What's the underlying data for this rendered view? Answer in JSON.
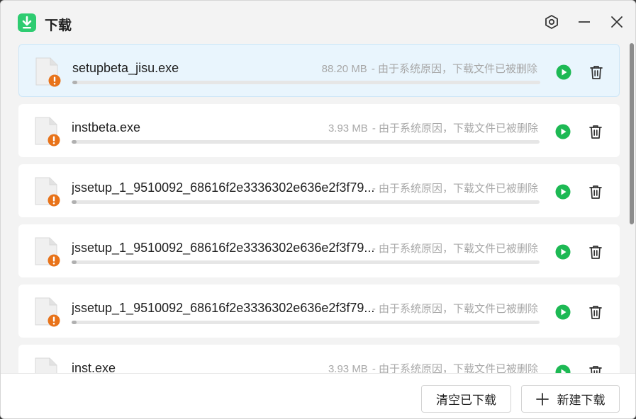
{
  "window": {
    "title": "下载",
    "app_icon": "download-arrow-icon",
    "controls": [
      "settings-icon",
      "minimize-icon",
      "close-icon"
    ]
  },
  "downloads": [
    {
      "name": "setupbeta_jisu.exe",
      "size": "88.20 MB",
      "status": "- 由于系统原因，下载文件已被删除",
      "progress": 0.01,
      "selected": true
    },
    {
      "name": "instbeta.exe",
      "size": "3.93 MB",
      "status": "- 由于系统原因，下载文件已被删除",
      "progress": 0.01,
      "selected": false
    },
    {
      "name": "jssetup_1_9510092_68616f2e3336302e636e2f3f79...",
      "size": "",
      "status": "- 由于系统原因，下载文件已被删除",
      "progress": 0.01,
      "selected": false
    },
    {
      "name": "jssetup_1_9510092_68616f2e3336302e636e2f3f79...",
      "size": "",
      "status": "- 由于系统原因，下载文件已被删除",
      "progress": 0.01,
      "selected": false
    },
    {
      "name": "jssetup_1_9510092_68616f2e3336302e636e2f3f79...",
      "size": "",
      "status": "- 由于系统原因，下载文件已被删除",
      "progress": 0.01,
      "selected": false
    },
    {
      "name": "inst.exe",
      "size": "3.93 MB",
      "status": "- 由于系统原因，下载文件已被删除",
      "progress": 0.01,
      "selected": false
    }
  ],
  "footer": {
    "clear_label": "清空已下载",
    "new_label": "新建下载"
  },
  "colors": {
    "play": "#1db954",
    "warning_badge": "#e8731a",
    "app_icon": "#2ecc71",
    "selected_bg": "#e9f5fd"
  }
}
